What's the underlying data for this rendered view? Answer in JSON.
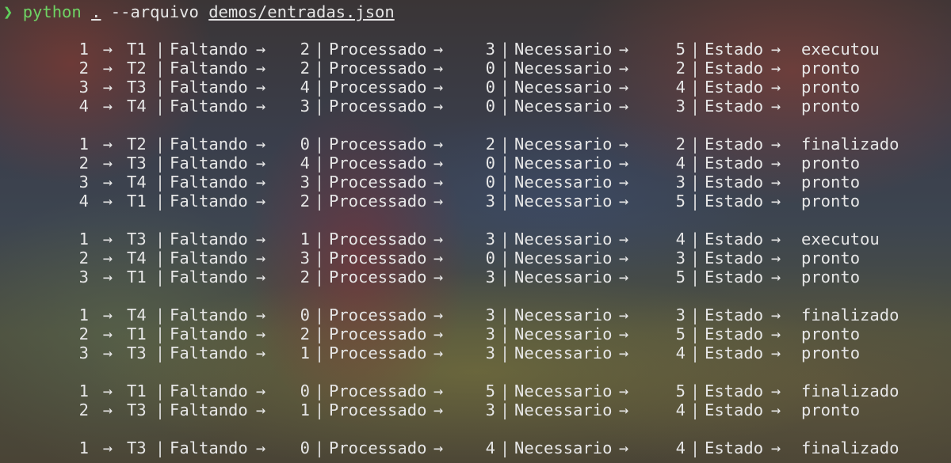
{
  "prompt": {
    "caret": "❯",
    "command": "python",
    "arg": ".",
    "flag": "--arquivo",
    "path": "demos/entradas.json"
  },
  "labels": {
    "arrow": "→",
    "sep": "|",
    "faltando": "Faltando",
    "processado": "Processado",
    "necessario": "Necessario",
    "estado": "Estado"
  },
  "blocks": [
    [
      {
        "idx": "1",
        "task": "T1",
        "faltando": "2",
        "processado": "3",
        "necessario": "5",
        "estado": "executou"
      },
      {
        "idx": "2",
        "task": "T2",
        "faltando": "2",
        "processado": "0",
        "necessario": "2",
        "estado": "pronto"
      },
      {
        "idx": "3",
        "task": "T3",
        "faltando": "4",
        "processado": "0",
        "necessario": "4",
        "estado": "pronto"
      },
      {
        "idx": "4",
        "task": "T4",
        "faltando": "3",
        "processado": "0",
        "necessario": "3",
        "estado": "pronto"
      }
    ],
    [
      {
        "idx": "1",
        "task": "T2",
        "faltando": "0",
        "processado": "2",
        "necessario": "2",
        "estado": "finalizado"
      },
      {
        "idx": "2",
        "task": "T3",
        "faltando": "4",
        "processado": "0",
        "necessario": "4",
        "estado": "pronto"
      },
      {
        "idx": "3",
        "task": "T4",
        "faltando": "3",
        "processado": "0",
        "necessario": "3",
        "estado": "pronto"
      },
      {
        "idx": "4",
        "task": "T1",
        "faltando": "2",
        "processado": "3",
        "necessario": "5",
        "estado": "pronto"
      }
    ],
    [
      {
        "idx": "1",
        "task": "T3",
        "faltando": "1",
        "processado": "3",
        "necessario": "4",
        "estado": "executou"
      },
      {
        "idx": "2",
        "task": "T4",
        "faltando": "3",
        "processado": "0",
        "necessario": "3",
        "estado": "pronto"
      },
      {
        "idx": "3",
        "task": "T1",
        "faltando": "2",
        "processado": "3",
        "necessario": "5",
        "estado": "pronto"
      }
    ],
    [
      {
        "idx": "1",
        "task": "T4",
        "faltando": "0",
        "processado": "3",
        "necessario": "3",
        "estado": "finalizado"
      },
      {
        "idx": "2",
        "task": "T1",
        "faltando": "2",
        "processado": "3",
        "necessario": "5",
        "estado": "pronto"
      },
      {
        "idx": "3",
        "task": "T3",
        "faltando": "1",
        "processado": "3",
        "necessario": "4",
        "estado": "pronto"
      }
    ],
    [
      {
        "idx": "1",
        "task": "T1",
        "faltando": "0",
        "processado": "5",
        "necessario": "5",
        "estado": "finalizado"
      },
      {
        "idx": "2",
        "task": "T3",
        "faltando": "1",
        "processado": "3",
        "necessario": "4",
        "estado": "pronto"
      }
    ],
    [
      {
        "idx": "1",
        "task": "T3",
        "faltando": "0",
        "processado": "4",
        "necessario": "4",
        "estado": "finalizado"
      }
    ]
  ]
}
